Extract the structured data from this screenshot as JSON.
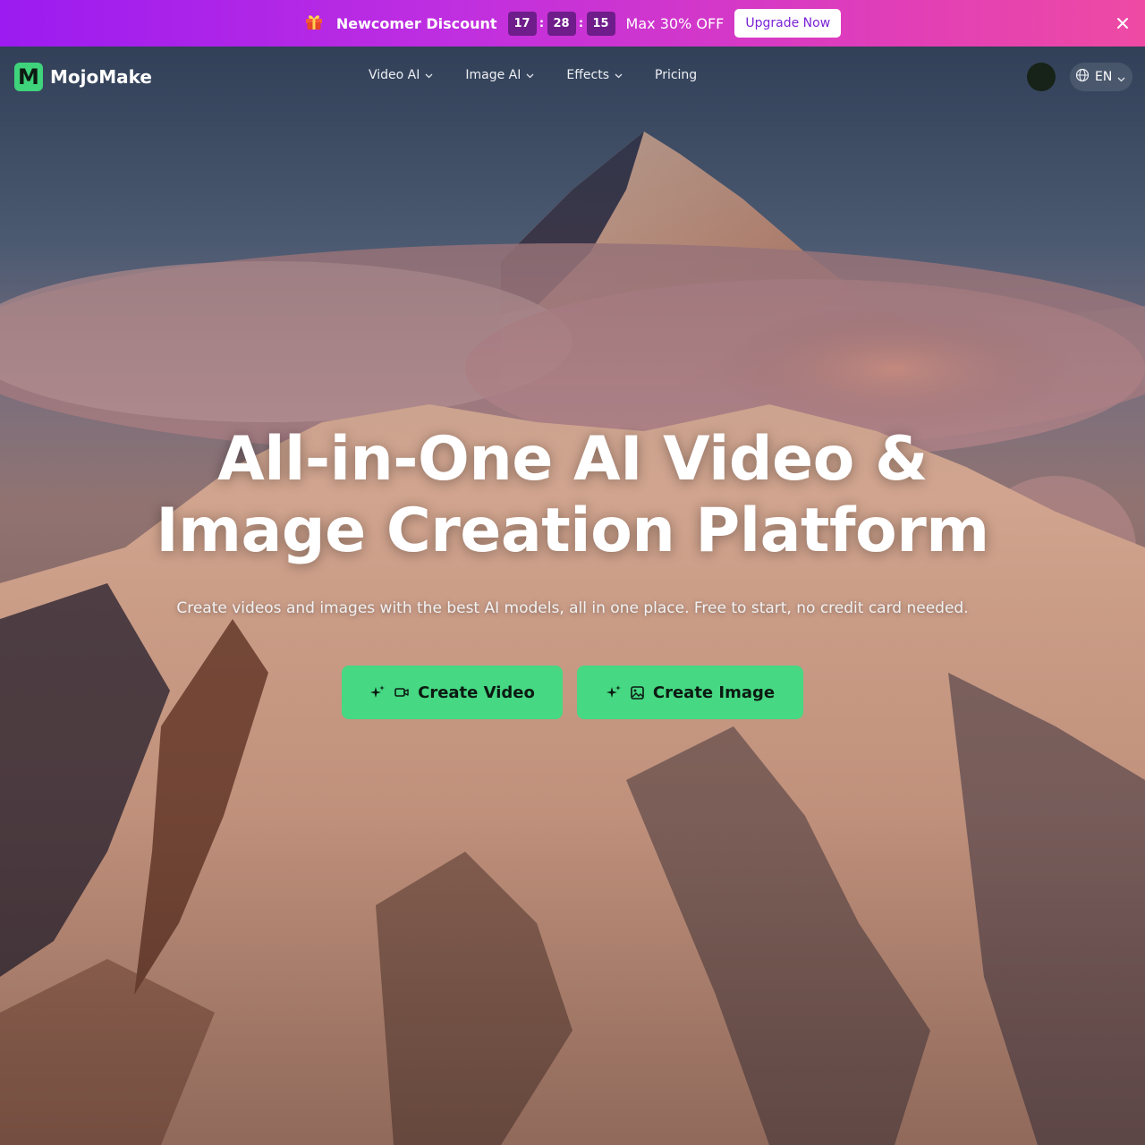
{
  "promo": {
    "gift_icon": "gift-icon",
    "title": "Newcomer Discount",
    "countdown": {
      "hours": "17",
      "minutes": "28",
      "seconds": "15",
      "separator": ":"
    },
    "offer": "Max 30% OFF",
    "cta": "Upgrade Now",
    "close_icon": "close-icon",
    "gradient_start": "#9b1bf0",
    "gradient_end": "#ee4aa4"
  },
  "nav": {
    "brand": {
      "logo_letter": "M",
      "name": "MojoMake",
      "logo_color": "#3fd37c"
    },
    "links": [
      {
        "label": "Video AI",
        "has_dropdown": true
      },
      {
        "label": "Image AI",
        "has_dropdown": true
      },
      {
        "label": "Effects",
        "has_dropdown": true
      },
      {
        "label": "Pricing",
        "has_dropdown": false
      }
    ],
    "language": {
      "icon": "globe-icon",
      "label": "EN"
    }
  },
  "hero": {
    "title_line1": "All-in-One AI Video &",
    "title_line2": "Image Creation Platform",
    "subtitle": "Create videos and images with the best AI models, all in one place. Free to start, no credit card needed.",
    "buttons": [
      {
        "label": "Create Video",
        "icons": [
          "sparkles-icon",
          "video-camera-icon"
        ]
      },
      {
        "label": "Create Image",
        "icons": [
          "sparkles-icon",
          "image-icon"
        ]
      }
    ],
    "accent": "#46d883",
    "background": "snowy mountain peak above clouds at sunset"
  }
}
